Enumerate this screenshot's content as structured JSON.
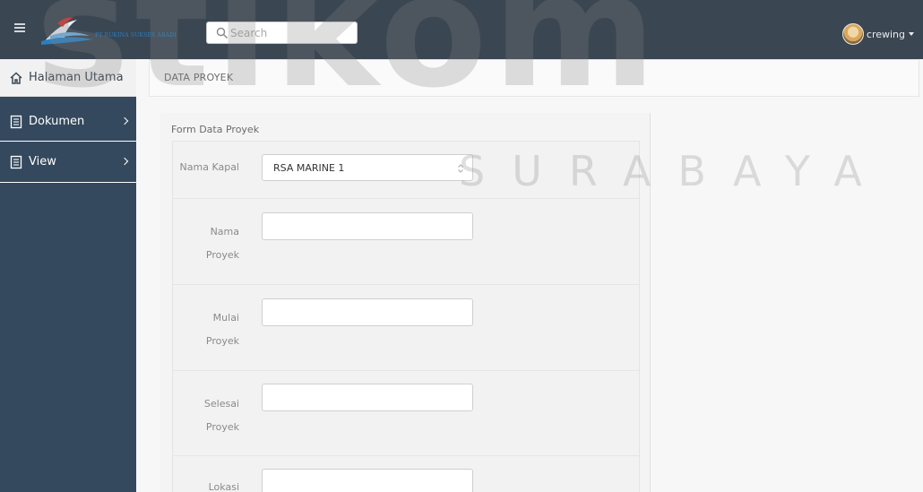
{
  "topbar": {
    "logo_text": "PT RUKINA SUKSES ABADI",
    "search_placeholder": "Search",
    "username": "crewing"
  },
  "sidebar": {
    "items": [
      {
        "label": "Halaman Utama",
        "icon": "home-icon"
      },
      {
        "label": "Dokumen",
        "icon": "document-icon"
      },
      {
        "label": "View",
        "icon": "document-icon"
      }
    ]
  },
  "breadcrumb": {
    "title": "DATA PROYEK"
  },
  "form": {
    "title": "Form Data Proyek",
    "nama_kapal": {
      "label": "Nama Kapal",
      "value": "RSA MARINE 1"
    },
    "nama_proyek": {
      "label_line1": "Nama",
      "label_line2": "Proyek",
      "value": ""
    },
    "mulai_proyek": {
      "label_line1": "Mulai",
      "label_line2": "Proyek",
      "value": ""
    },
    "selesai_proyek": {
      "label_line1": "Selesai",
      "label_line2": "Proyek",
      "value": ""
    },
    "lokasi": {
      "label_line1": "Lokasi",
      "value": ""
    }
  },
  "watermark": {
    "brand": "stikom",
    "city": "SURABAYA"
  },
  "colors": {
    "topbar": "#3a4651",
    "sidebar": "#34495e",
    "watermark": "#8c8c8c"
  }
}
